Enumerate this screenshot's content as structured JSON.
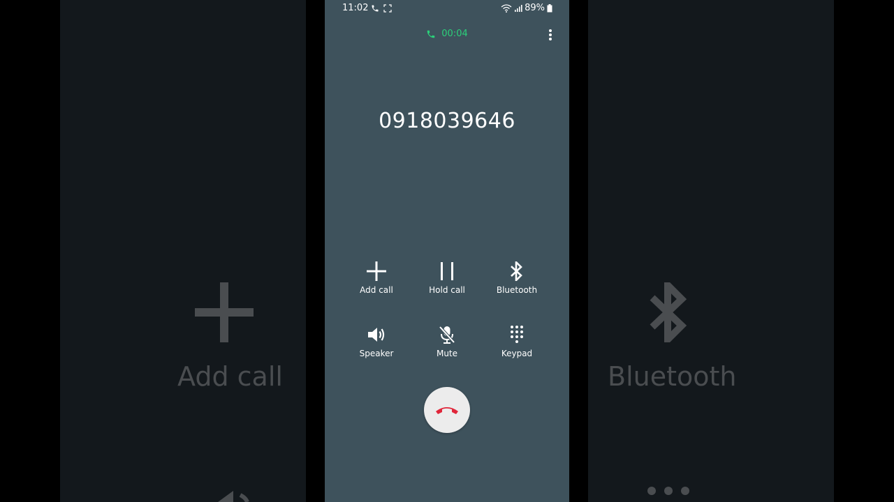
{
  "status_bar": {
    "time": "11:02",
    "battery": "89%"
  },
  "call": {
    "timer": "00:04",
    "number": "0918039646"
  },
  "controls": {
    "add_call": "Add call",
    "hold_call": "Hold call",
    "bluetooth": "Bluetooth",
    "speaker": "Speaker",
    "mute": "Mute",
    "keypad": "Keypad"
  },
  "background_left": {
    "label": "Add call"
  },
  "background_right": {
    "label": "Bluetooth"
  },
  "colors": {
    "screen_bg": "#3e525c",
    "timer_green": "#2bd07a",
    "end_call_red": "#e0263a"
  }
}
